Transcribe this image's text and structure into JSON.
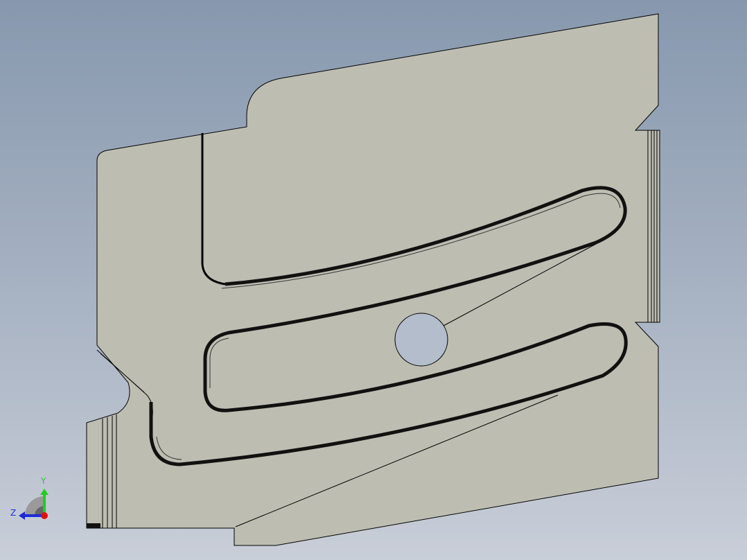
{
  "viewport": {
    "part_fill": "#bebdb2",
    "edge_color": "#000000",
    "hole_fill": "#b3bdcc"
  },
  "triad": {
    "y_label": "Y",
    "z_label": "Z",
    "y_color": "#22cc22",
    "z_color": "#1a2bdb",
    "x_color": "#e01010"
  }
}
